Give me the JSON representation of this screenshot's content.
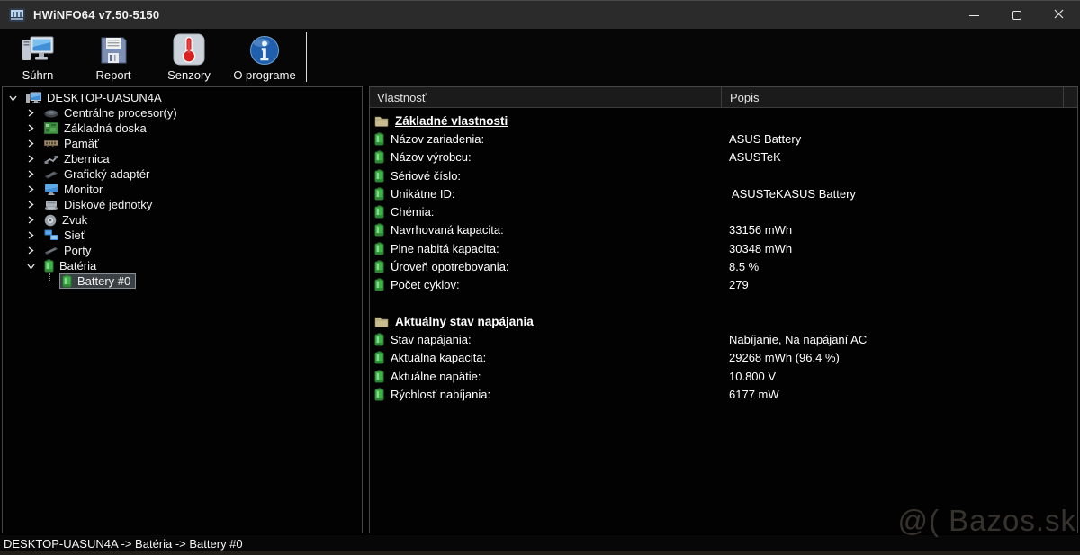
{
  "window": {
    "title": "HWiNFO64 v7.50-5150",
    "app_icon": "hwinfo-logo-icon"
  },
  "toolbar": {
    "buttons": [
      {
        "label": "Súhrn",
        "icon": "computer-summary-icon"
      },
      {
        "label": "Report",
        "icon": "floppy-report-icon"
      },
      {
        "label": "Senzory",
        "icon": "thermometer-sensors-icon"
      },
      {
        "label": "O programe",
        "icon": "info-about-icon"
      }
    ]
  },
  "tree": {
    "items": [
      {
        "label": "DESKTOP-UASUN4A",
        "icon": "computer-icon",
        "level": 0,
        "expanded": true
      },
      {
        "label": "Centrálne procesor(y)",
        "icon": "cpu-icon",
        "level": 1,
        "expanded": false
      },
      {
        "label": "Základná doska",
        "icon": "motherboard-icon",
        "level": 1,
        "expanded": false
      },
      {
        "label": "Pamäť",
        "icon": "memory-icon",
        "level": 1,
        "expanded": false
      },
      {
        "label": "Zbernica",
        "icon": "bus-icon",
        "level": 1,
        "expanded": false
      },
      {
        "label": "Grafický adaptér",
        "icon": "gpu-icon",
        "level": 1,
        "expanded": false
      },
      {
        "label": "Monitor",
        "icon": "monitor-icon",
        "level": 1,
        "expanded": false
      },
      {
        "label": "Diskové jednotky",
        "icon": "disk-icon",
        "level": 1,
        "expanded": false
      },
      {
        "label": "Zvuk",
        "icon": "audio-icon",
        "level": 1,
        "expanded": false
      },
      {
        "label": "Sieť",
        "icon": "network-icon",
        "level": 1,
        "expanded": false
      },
      {
        "label": "Porty",
        "icon": "ports-icon",
        "level": 1,
        "expanded": false
      },
      {
        "label": "Batéria",
        "icon": "battery-icon",
        "level": 1,
        "expanded": true
      },
      {
        "label": "Battery #0",
        "icon": "battery-icon",
        "level": 2,
        "selected": true
      }
    ]
  },
  "properties_panel": {
    "columns": [
      "Vlastnosť",
      "Popis"
    ],
    "sections": [
      {
        "title": "Základné vlastnosti",
        "rows": [
          {
            "label": "Názov zariadenia:",
            "value": "ASUS Battery"
          },
          {
            "label": "Názov výrobcu:",
            "value": "ASUSTeK"
          },
          {
            "label": "Sériové číslo:",
            "value": ""
          },
          {
            "label": "Unikátne ID:",
            "value": " ASUSTeKASUS Battery"
          },
          {
            "label": "Chémia:",
            "value": ""
          },
          {
            "label": "Navrhovaná kapacita:",
            "value": "33156 mWh"
          },
          {
            "label": "Plne nabitá kapacita:",
            "value": "30348 mWh"
          },
          {
            "label": "Úroveň opotrebovania:",
            "value": "8.5 %"
          },
          {
            "label": "Počet cyklov:",
            "value": "279"
          }
        ]
      },
      {
        "title": "Aktuálny stav napájania",
        "rows": [
          {
            "label": "Stav napájania:",
            "value": "Nabíjanie, Na napájaní AC"
          },
          {
            "label": "Aktuálna kapacita:",
            "value": "29268 mWh (96.4 %)"
          },
          {
            "label": "Aktuálne napätie:",
            "value": "10.800 V"
          },
          {
            "label": "Rýchlosť nabíjania:",
            "value": "6177 mW"
          }
        ]
      }
    ]
  },
  "status_bar": {
    "text": "DESKTOP-UASUN4A -> Batéria -> Battery #0"
  },
  "watermark": {
    "text": "@( Bazos.sk"
  },
  "colors": {
    "titlebar_bg": "#2b2b2b",
    "panel_bg": "#020202",
    "panel_border": "#454545",
    "battery_green": "#3fb24a",
    "folder_tan": "#c9bd8f",
    "selection_bg": "#3a4043",
    "selection_border": "#878d91",
    "thermometer_red": "#d92020",
    "info_blue": "#1f5fae",
    "screen_blue": "#3f8fd9"
  }
}
